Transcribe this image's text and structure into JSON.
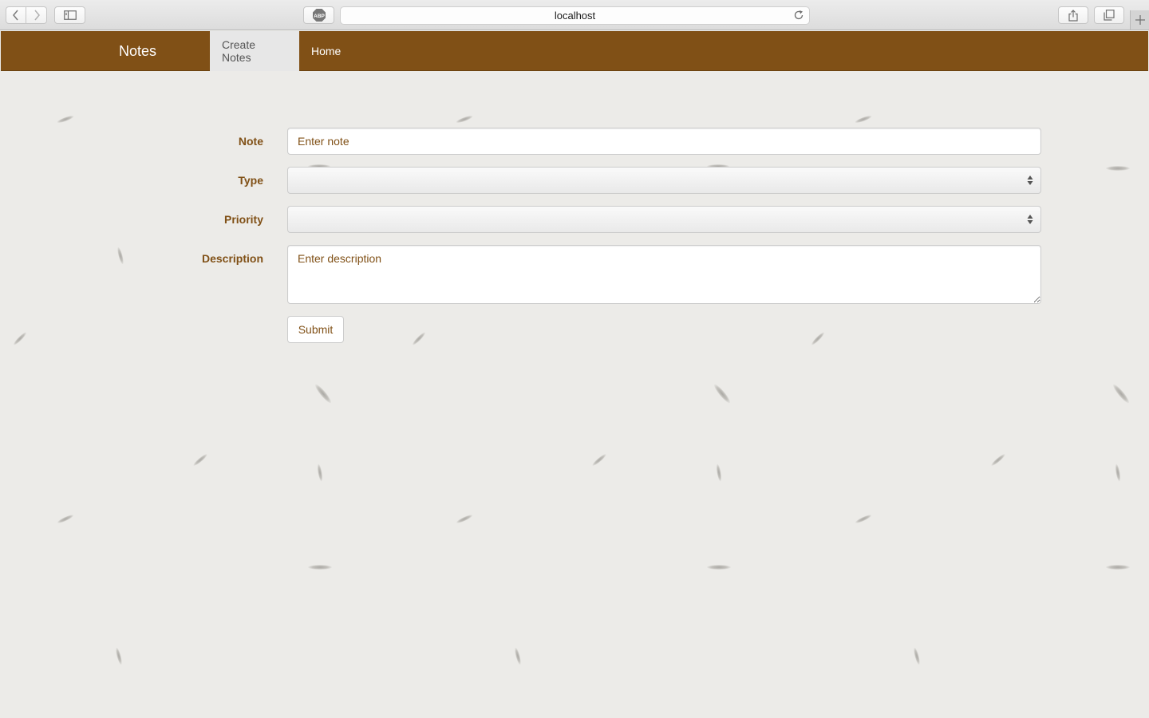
{
  "browser": {
    "url": "localhost",
    "adblock_label": "ABP"
  },
  "navbar": {
    "brand": "Notes",
    "items": [
      {
        "label": "Create Notes",
        "active": true
      },
      {
        "label": "Home",
        "active": false
      }
    ]
  },
  "form": {
    "note": {
      "label": "Note",
      "placeholder": "Enter note",
      "value": ""
    },
    "type": {
      "label": "Type",
      "selected": ""
    },
    "priority": {
      "label": "Priority",
      "selected": ""
    },
    "description": {
      "label": "Description",
      "placeholder": "Enter description",
      "value": ""
    },
    "submit_label": "Submit"
  },
  "colors": {
    "accent": "#805016",
    "background": "#ecebe8",
    "nav_active_bg": "#e7e7e7"
  },
  "icons": [
    "back-arrow-icon",
    "forward-arrow-icon",
    "sidebar-icon",
    "adblock-icon",
    "reload-icon",
    "share-icon",
    "tabs-icon",
    "plus-icon",
    "select-arrows-icon"
  ]
}
